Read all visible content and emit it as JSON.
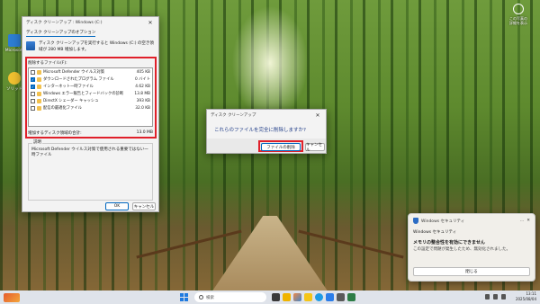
{
  "desktop": {
    "icons": [
      {
        "label": "Microsoft"
      },
      {
        "label": "ソリッド"
      }
    ],
    "top_right": {
      "line1": "この写真の",
      "line2": "詳細を表示"
    }
  },
  "cleanup_dialog": {
    "title": "ディスク クリーンアップ : Windows (C:)",
    "tab": "ディスク クリーンアップのオプション",
    "description": "ディスク クリーンアップを実行すると Windows (C:) の空き領域が 280 MB 増加します。",
    "list_label": "削除するファイル(F):",
    "files": [
      {
        "name": "Microsoft Defender ウイルス対策",
        "size": "405 KB",
        "checked": false
      },
      {
        "name": "ダウンロードされたプログラム ファイル",
        "size": "0 バイト",
        "checked": true
      },
      {
        "name": "インターネット一時ファイル",
        "size": "4.62 KB",
        "checked": true
      },
      {
        "name": "Windows エラー報告とフィードバックの診断",
        "size": "13.8 MB",
        "checked": false
      },
      {
        "name": "DirectX シェーダー キャッシュ",
        "size": "393 KB",
        "checked": false
      },
      {
        "name": "配信の最適化ファイル",
        "size": "32.0 KB",
        "checked": false
      }
    ],
    "total_label": "増加するディスク領域の合計:",
    "total_value": "13.0 MB",
    "desc_group_label": "説明",
    "desc_text": "Microsoft Defender ウイルス対策で使用される重要ではない一時ファイル",
    "ok_label": "OK",
    "cancel_label": "キャンセル"
  },
  "confirm_dialog": {
    "title": "ディスク クリーンアップ",
    "message": "これらのファイルを完全に削除しますか?",
    "delete_label": "ファイルの削除",
    "cancel_label": "キャンセル"
  },
  "notification": {
    "header": "Windows セキュリティ",
    "app_name": "Windows セキュリティ",
    "title": "メモリの整合性を有効にできません",
    "body": "この設定で問題が発生したため、無効化されました。",
    "close_label": "閉じる"
  },
  "taskbar": {
    "search_placeholder": "検索",
    "time": "13:11",
    "date": "2025/08/04"
  }
}
